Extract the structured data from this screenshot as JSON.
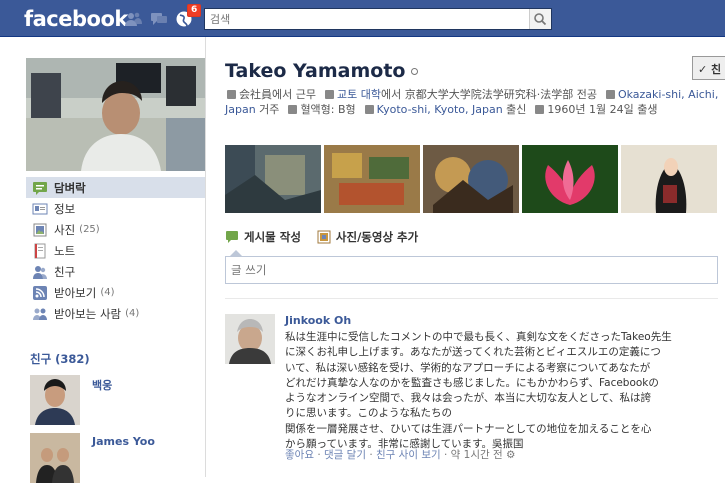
{
  "topbar": {
    "logo": "facebook",
    "notification_count": "6",
    "search_placeholder": "검색"
  },
  "profile": {
    "name": "Takeo Yamamoto",
    "friend_button_label": "✓ 친",
    "info": {
      "work": "会社員에서 근무",
      "school_prefix": "교토 대학",
      "school_suffix": "에서 京都大学大学院法学研究科·法学部 전공",
      "lives_link": "Okazaki-shi, Aichi, Japan",
      "lives_suffix": " 거주",
      "blood": "혈액형: B형",
      "from_link": "Kyoto-shi, Kyoto, Japan",
      "from_suffix": " 출신",
      "birthday": "1960년 1월 24일 출생"
    }
  },
  "nav": {
    "items": [
      {
        "label": "담벼락",
        "icon": "wall-icon",
        "count": ""
      },
      {
        "label": "정보",
        "icon": "info-icon",
        "count": ""
      },
      {
        "label": "사진",
        "icon": "photos-icon",
        "count": "(25)"
      },
      {
        "label": "노트",
        "icon": "notes-icon",
        "count": ""
      },
      {
        "label": "친구",
        "icon": "friends-icon",
        "count": ""
      },
      {
        "label": "받아보기",
        "icon": "subscriptions-icon",
        "count": "(4)"
      },
      {
        "label": "받아보는 사람",
        "icon": "subscribers-icon",
        "count": "(4)"
      }
    ]
  },
  "friends": {
    "heading": "친구 (382)",
    "list": [
      {
        "name": "백웅"
      },
      {
        "name": "James Yoo"
      }
    ]
  },
  "composer": {
    "tab_status": "게시물 작성",
    "tab_photo": "사진/동영상 추가",
    "placeholder": "글 쓰기"
  },
  "story": {
    "author": "Jinkook Oh",
    "lines": [
      "私は生涯中に受信したコメントの中で最も長く、真剣な文をくださったTakeo先生",
      "に深くお礼申し上げます。あなたが送ってくれた芸術とビィエスルエの定義につ",
      "いて、私は深い感銘を受け、学術的なアプローチによる考察についてあなたが",
      "どれだけ真摯な人なのかを監査さも感じました。にもかかわらず、Facebookの",
      "ようなオンライン空間で、我々は会ったが、本当に大切な友人として、私は誇",
      "りに思います。このような私たちの",
      "関係を一層発展させ、ひいては生涯パートナーとしての地位を加えることを心",
      "から願っています。非常に感謝しています。吳振国"
    ],
    "meta_like": "좋아요",
    "meta_comment": "댓글 달기",
    "meta_friendship": "친구 사이 보기",
    "meta_time": "약 1시간 전"
  },
  "colors": {
    "brand_blue": "#3b5998",
    "nav_active_bg": "#d8dfea",
    "link": "#3b5998"
  }
}
